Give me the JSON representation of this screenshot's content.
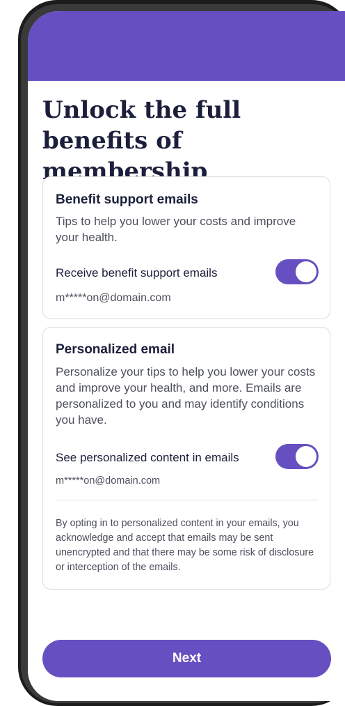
{
  "header": {
    "title": "Unlock the full benefits of membership",
    "accent_color": "#6650c1"
  },
  "benefit_card": {
    "title": "Benefit support emails",
    "description": "Tips to help you lower your costs and improve your health.",
    "toggle_label": "Receive benefit support emails",
    "toggle_on": true,
    "email": "m*****on@domain.com"
  },
  "personalized_card": {
    "title": "Personalized email",
    "description": "Personalize your tips to help you lower your costs and improve your health, and more. Emails are personalized to you and may identify conditions you have.",
    "toggle_label": "See personalized content in emails",
    "toggle_on": true,
    "email": "m*****on@domain.com",
    "disclaimer": "By opting in to personalized content in your emails, you acknowledge and accept that emails may be sent unencrypted and that there may be some risk of disclosure or interception of the emails."
  },
  "footer": {
    "next_label": "Next"
  }
}
